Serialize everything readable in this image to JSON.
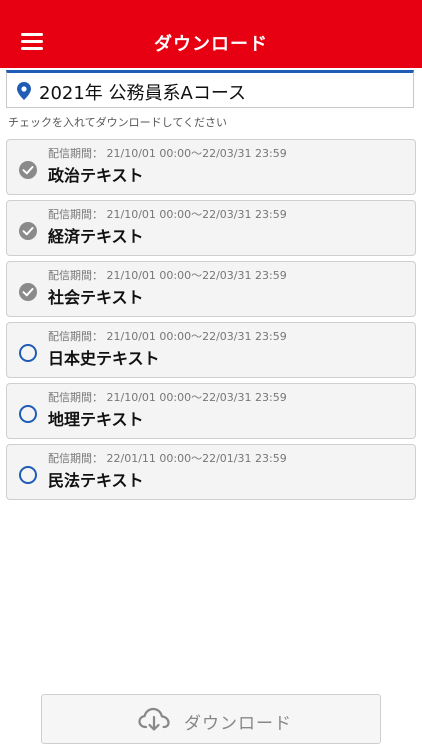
{
  "header": {
    "title": "ダウンロード"
  },
  "course": {
    "name": "2021年 公務員系Aコース"
  },
  "instruction": "チェックを入れてダウンロードしてください",
  "items": [
    {
      "period": "配信期間： 21/10/01 00:00～22/03/31 23:59",
      "title": "政治テキスト",
      "checked": true
    },
    {
      "period": "配信期間： 21/10/01 00:00～22/03/31 23:59",
      "title": "経済テキスト",
      "checked": true
    },
    {
      "period": "配信期間： 21/10/01 00:00～22/03/31 23:59",
      "title": "社会テキスト",
      "checked": true
    },
    {
      "period": "配信期間： 21/10/01 00:00～22/03/31 23:59",
      "title": "日本史テキスト",
      "checked": false
    },
    {
      "period": "配信期間： 21/10/01 00:00～22/03/31 23:59",
      "title": "地理テキスト",
      "checked": false
    },
    {
      "period": "配信期間： 22/01/11 00:00～22/01/31 23:59",
      "title": "民法テキスト",
      "checked": false
    }
  ],
  "footer": {
    "download_label": "ダウンロード"
  },
  "colors": {
    "brand_red": "#e60012",
    "accent_blue": "#1f5cb6",
    "checked_gray": "#8a8a8a"
  },
  "icons": {
    "menu": "hamburger-icon",
    "location": "location-pin-icon",
    "checked": "check-circle-icon",
    "unchecked": "empty-circle-icon",
    "download": "cloud-download-icon"
  }
}
